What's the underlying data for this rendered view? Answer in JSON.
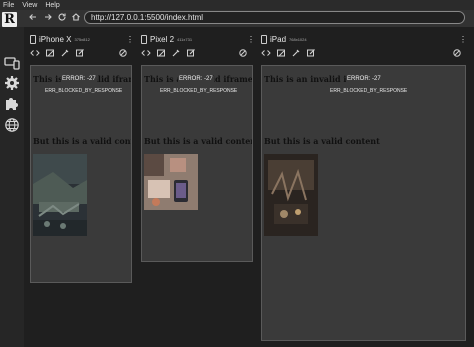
{
  "menu": [
    "File",
    "View",
    "Help"
  ],
  "address": {
    "url": "http://127.0.0.1:5500/index.html"
  },
  "logo": "R",
  "devices": [
    {
      "name": "iPhone X",
      "res": "375x812"
    },
    {
      "name": "Pixel 2",
      "res": "411x731"
    },
    {
      "name": "iPad",
      "res": "768x1024"
    }
  ],
  "content": {
    "heading_invalid": "This is an invalid iframe",
    "error_title": "ERROR: -27",
    "error_detail": "ERR_BLOCKED_BY_RESPONSE",
    "heading_valid": "But this is a valid content"
  },
  "colors": {
    "frame_bg": "#3a3a3a",
    "app_bg": "#1f1f1f",
    "sidebar_bg": "#262626"
  }
}
